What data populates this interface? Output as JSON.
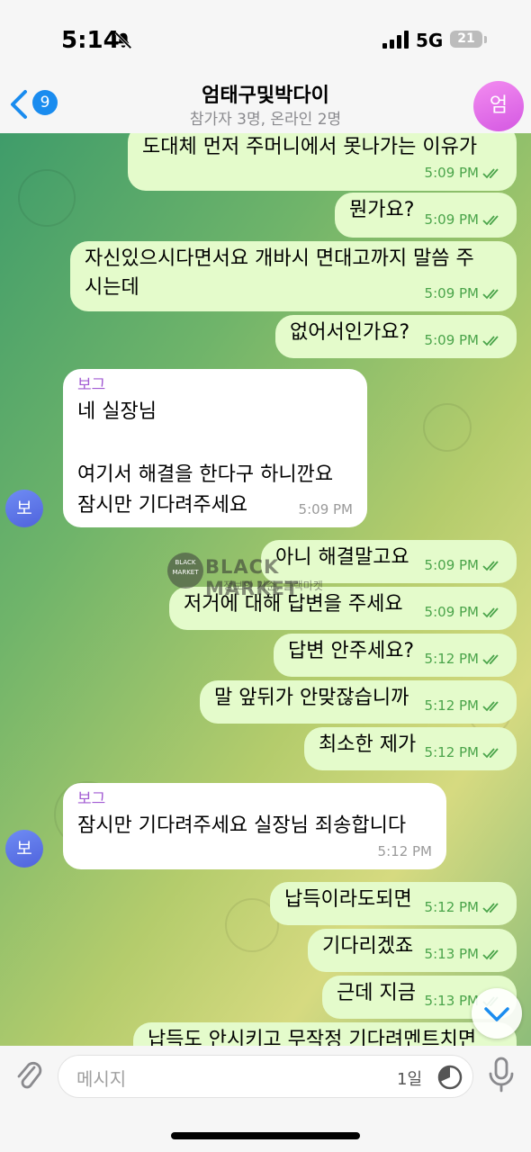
{
  "status_bar": {
    "time": "5:14",
    "network": "5G",
    "battery": "21"
  },
  "header": {
    "back_badge": "9",
    "title": "엄태구및박다이",
    "subtitle": "참가자 3명, 온라인 2명",
    "avatar": "엄"
  },
  "messages": [
    {
      "dir": "out",
      "text": "도대체 먼저 주머니에서 못나가는 이유가",
      "time": "5:09 PM"
    },
    {
      "dir": "out",
      "text": "뭔가요?",
      "time": "5:09 PM"
    },
    {
      "dir": "out",
      "lines": [
        "자신있으시다면서요 개바시 면대고까지 말씀 주",
        "시는데"
      ],
      "time": "5:09 PM"
    },
    {
      "dir": "out",
      "text": "없어서인가요?",
      "time": "5:09 PM"
    },
    {
      "dir": "in",
      "sender": "보그",
      "lines": [
        "네 실장님",
        "",
        "여기서 해결을 한다구 하니깐요",
        "잠시만 기다려주세요"
      ],
      "time": "5:09 PM",
      "avatar": "보"
    },
    {
      "dir": "out",
      "text": "아니 해결말고요",
      "time": "5:09 PM"
    },
    {
      "dir": "out",
      "text": "저거에 대해 답변을 주세요",
      "time": "5:09 PM"
    },
    {
      "dir": "out",
      "text": "답변 안주세요?",
      "time": "5:12 PM"
    },
    {
      "dir": "out",
      "text": "말 앞뒤가 안맞잖습니까",
      "time": "5:12 PM"
    },
    {
      "dir": "out",
      "text": "최소한 제가",
      "time": "5:12 PM"
    },
    {
      "dir": "in",
      "sender": "보그",
      "lines": [
        "잠시만 기다려주세요 실장님 죄송합니다"
      ],
      "time": "5:12 PM",
      "avatar": "보"
    },
    {
      "dir": "out",
      "text": "납득이라도되면",
      "time": "5:12 PM"
    },
    {
      "dir": "out",
      "text": "기다리겠죠",
      "time": "5:13 PM"
    },
    {
      "dir": "out",
      "text": "근데 지금",
      "time": "5:13 PM"
    },
    {
      "dir": "out",
      "text": "납득도 안시키고 무작정 기다려멘트치면"
    }
  ],
  "watermark": {
    "badge": "BLACK MARKET",
    "name": "BLACK MARKET",
    "tagline": "정보의 기준, 블랙마켓"
  },
  "input": {
    "placeholder": "메시지",
    "day_label": "1일"
  },
  "colors": {
    "outgoing_bubble": "#e4fbcb",
    "incoming_bubble": "#ffffff",
    "accent": "#1a8cef",
    "check": "#4aa44a"
  },
  "icons": [
    "bell-slash-icon",
    "signal-icon",
    "chevron-left-icon",
    "paperclip-icon",
    "timer-icon",
    "microphone-icon",
    "chevron-down-icon",
    "double-check-icon"
  ]
}
